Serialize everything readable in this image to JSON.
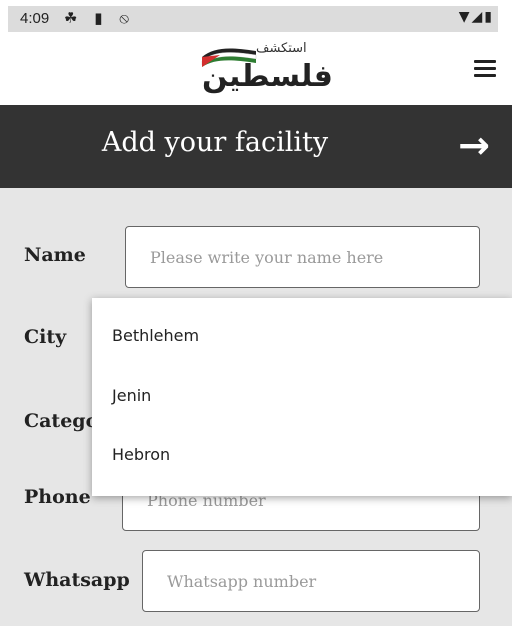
{
  "status_bar": {
    "time": "4:09",
    "left_icons": "☘ ▮ ⦸",
    "right_icons": "▼◢▮"
  },
  "app": {
    "logo_small_text": "استكشف",
    "logo_big_text": "فلسطين"
  },
  "header": {
    "title": "Add your facility",
    "arrow": "→"
  },
  "form": {
    "name": {
      "label": "Name",
      "placeholder": "Please write your name here"
    },
    "city": {
      "label": "City"
    },
    "category": {
      "label": "Catego"
    },
    "phone": {
      "label": "Phone",
      "placeholder": "Phone number"
    },
    "whatsapp": {
      "label": "Whatsapp",
      "placeholder": "Whatsapp number"
    }
  },
  "city_dropdown": {
    "options": [
      "Bethlehem",
      "Jenin",
      "Hebron"
    ]
  },
  "colors": {
    "header_bg": "#333333",
    "page_bg": "#e6e6e6",
    "flag_red": "#d32f2f",
    "flag_green": "#2e7d32"
  }
}
